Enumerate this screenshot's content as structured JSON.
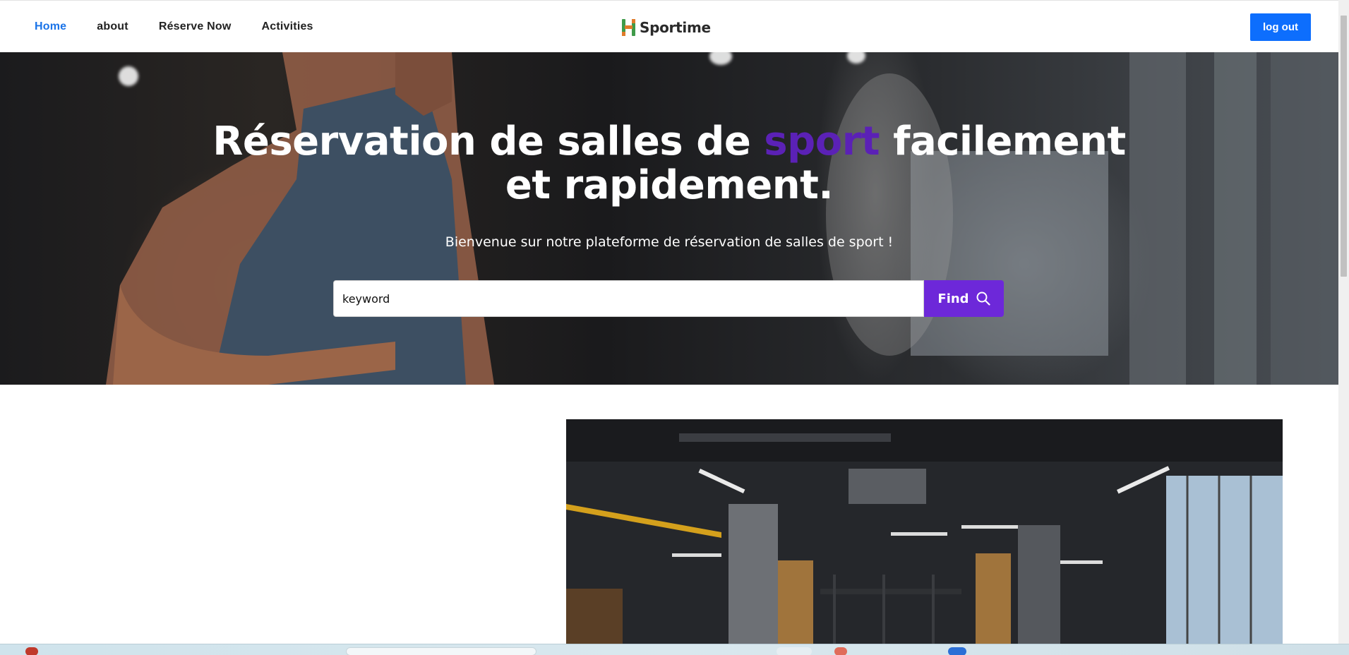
{
  "nav": {
    "links": [
      {
        "label": "Home",
        "active": true
      },
      {
        "label": "about",
        "active": false
      },
      {
        "label": "Réserve Now",
        "active": false
      },
      {
        "label": "Activities",
        "active": false
      }
    ],
    "brand": "Sportime",
    "logout_label": "log out"
  },
  "hero": {
    "title_part1": "Réservation de salles de ",
    "title_accent": "sport",
    "title_part2": " facilement",
    "title_line2": "et rapidement.",
    "subtitle": "Bienvenue sur notre plateforme de réservation de salles de sport !",
    "search_value": "keyword",
    "find_label": "Find"
  },
  "colors": {
    "accent_purple": "#6d28d9",
    "title_accent": "#5b21b6",
    "nav_active": "#1a73e8",
    "logout_bg": "#0d6efd"
  }
}
